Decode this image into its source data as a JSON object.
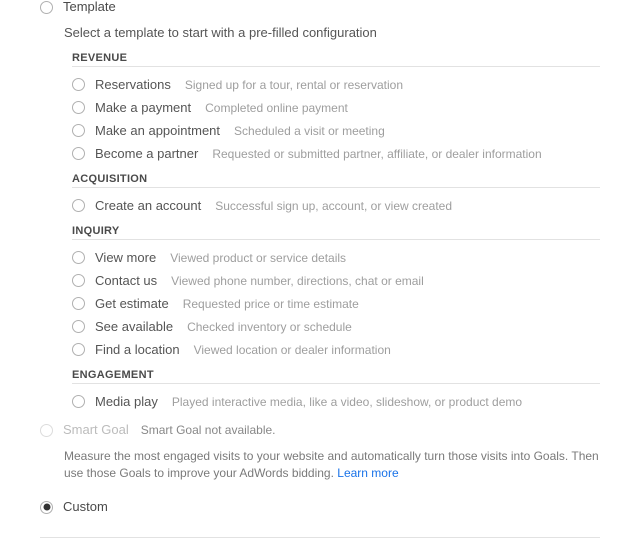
{
  "template_option": {
    "label": "Template",
    "subtitle": "Select a template to start with a pre-filled configuration"
  },
  "groups": [
    {
      "header": "REVENUE",
      "items": [
        {
          "label": "Reservations",
          "desc": "Signed up for a tour, rental or reservation"
        },
        {
          "label": "Make a payment",
          "desc": "Completed online payment"
        },
        {
          "label": "Make an appointment",
          "desc": "Scheduled a visit or meeting"
        },
        {
          "label": "Become a partner",
          "desc": "Requested or submitted partner, affiliate, or dealer information"
        }
      ]
    },
    {
      "header": "ACQUISITION",
      "items": [
        {
          "label": "Create an account",
          "desc": "Successful sign up, account, or view created"
        }
      ]
    },
    {
      "header": "INQUIRY",
      "items": [
        {
          "label": "View more",
          "desc": "Viewed product or service details"
        },
        {
          "label": "Contact us",
          "desc": "Viewed phone number, directions, chat or email"
        },
        {
          "label": "Get estimate",
          "desc": "Requested price or time estimate"
        },
        {
          "label": "See available",
          "desc": "Checked inventory or schedule"
        },
        {
          "label": "Find a location",
          "desc": "Viewed location or dealer information"
        }
      ]
    },
    {
      "header": "ENGAGEMENT",
      "items": [
        {
          "label": "Media play",
          "desc": "Played interactive media, like a video, slideshow, or product demo"
        }
      ]
    }
  ],
  "smart_goal": {
    "label": "Smart Goal",
    "status": "Smart Goal not available.",
    "desc": "Measure the most engaged visits to your website and automatically turn those visits into Goals. Then use those Goals to improve your AdWords bidding. ",
    "link": "Learn more"
  },
  "custom_option": {
    "label": "Custom"
  }
}
